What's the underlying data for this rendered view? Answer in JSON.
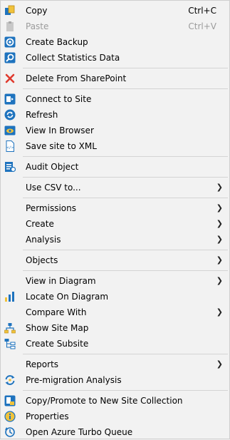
{
  "menu": {
    "copy": {
      "label": "Copy",
      "shortcut": "Ctrl+C",
      "icon": "copy-icon"
    },
    "paste": {
      "label": "Paste",
      "shortcut": "Ctrl+V",
      "icon": "paste-icon",
      "disabled": true
    },
    "create_backup": {
      "label": "Create Backup",
      "icon": "backup-icon"
    },
    "collect_statistics": {
      "label": "Collect Statistics Data",
      "icon": "statistics-icon"
    },
    "delete_from_sharepoint": {
      "label": "Delete From SharePoint",
      "icon": "delete-icon"
    },
    "connect_to_site": {
      "label": "Connect to Site",
      "icon": "sharepoint-connect-icon"
    },
    "refresh": {
      "label": "Refresh",
      "icon": "refresh-icon"
    },
    "view_in_browser": {
      "label": "View In Browser",
      "icon": "browser-icon"
    },
    "save_site_to_xml": {
      "label": "Save site to XML",
      "icon": "xml-icon"
    },
    "audit_object": {
      "label": "Audit Object",
      "icon": "audit-icon"
    },
    "use_csv_to": {
      "label": "Use CSV to...",
      "submenu": true
    },
    "permissions": {
      "label": "Permissions",
      "submenu": true
    },
    "create": {
      "label": "Create",
      "submenu": true
    },
    "analysis": {
      "label": "Analysis",
      "submenu": true
    },
    "objects": {
      "label": "Objects",
      "submenu": true
    },
    "view_in_diagram": {
      "label": "View in Diagram",
      "submenu": true
    },
    "locate_on_diagram": {
      "label": "Locate On Diagram",
      "icon": "diagram-chart-icon"
    },
    "compare_with": {
      "label": "Compare With",
      "submenu": true
    },
    "show_site_map": {
      "label": "Show Site Map",
      "icon": "site-map-icon"
    },
    "create_subsite": {
      "label": "Create Subsite",
      "icon": "subsite-icon"
    },
    "reports": {
      "label": "Reports",
      "submenu": true
    },
    "pre_migration_analysis": {
      "label": "Pre-migration Analysis",
      "icon": "migration-icon"
    },
    "copy_promote": {
      "label": "Copy/Promote to New Site Collection",
      "icon": "promote-icon"
    },
    "properties": {
      "label": "Properties",
      "icon": "properties-icon"
    },
    "open_azure_turbo": {
      "label": "Open Azure Turbo Queue",
      "icon": "azure-queue-icon"
    }
  },
  "colors": {
    "menu_bg": "#f2f2f2",
    "separator": "#d4d4d4",
    "disabled_text": "#9c9c9c",
    "icon_blue": "#1e73be",
    "delete_red": "#e03a2e"
  }
}
